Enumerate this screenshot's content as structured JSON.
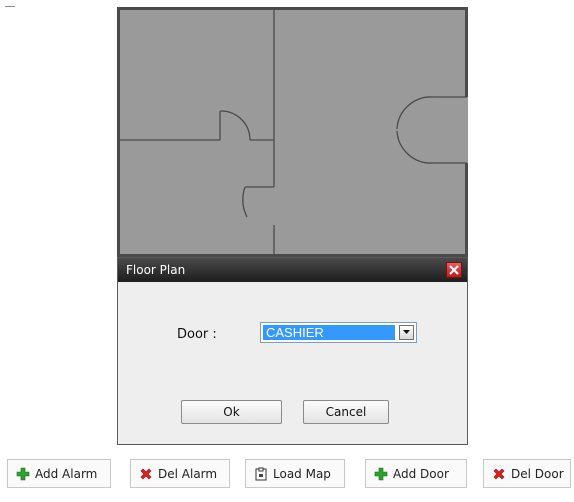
{
  "dialog": {
    "title": "Floor Plan",
    "door_label": "Door :",
    "door_selected": "CASHIER",
    "ok_label": "Ok",
    "cancel_label": "Cancel"
  },
  "toolbar": {
    "add_alarm": "Add Alarm",
    "del_alarm": "Del Alarm",
    "load_map": "Load Map",
    "add_door": "Add Door",
    "del_door": "Del Door"
  },
  "icons": {
    "add": "plus-icon",
    "delete": "x-icon",
    "load": "clipboard-icon",
    "close": "close-icon",
    "dropdown": "chevron-down-icon"
  },
  "colors": {
    "map_bg": "#9a9a9a",
    "selection": "#3399ff",
    "add_green": "#2ea02e",
    "delete_red": "#e02020"
  }
}
